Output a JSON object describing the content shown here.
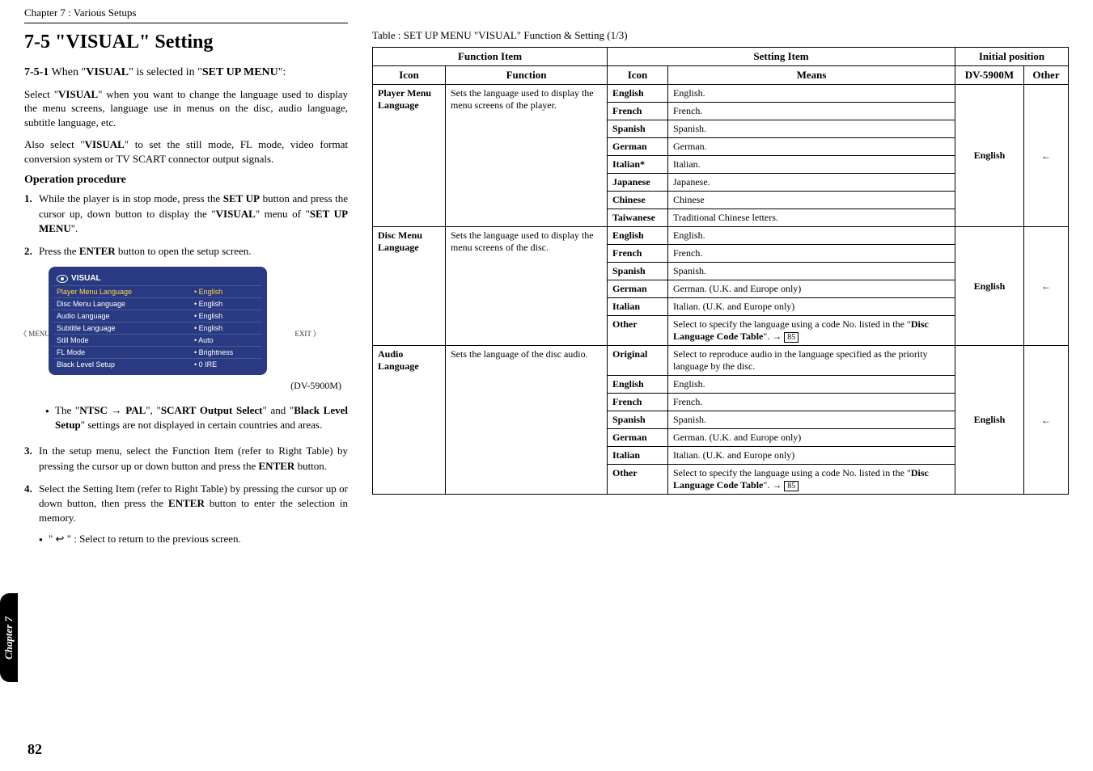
{
  "chapter_header": "Chapter 7 : Various Setups",
  "section": {
    "number": "7-5",
    "title": "\"VISUAL\" Setting",
    "sub_number": "7-5-1",
    "sub_text_pre": "When \"",
    "sub_kw1": "VISUAL",
    "sub_text_mid": "\" is selected in \"",
    "sub_kw2": "SET UP MENU",
    "sub_text_post": "\":",
    "para1_a": "Select \"",
    "para1_kw": "VISUAL",
    "para1_b": "\" when you want to change the language used to display the menu screens, language use in menus on the disc, audio language, subtitle language, etc.",
    "para2_a": "Also select \"",
    "para2_kw": "VISUAL",
    "para2_b": "\" to set the still mode, FL mode, video format conversion system or TV SCART connector output signals.",
    "op_proc": "Operation procedure",
    "steps": {
      "s1_a": "While the player is in stop mode, press the ",
      "s1_kw1": "SET UP",
      "s1_b": " button and press the cursor up, down button to display the \"",
      "s1_kw2": "VISUAL",
      "s1_c": "\" menu of \"",
      "s1_kw3": "SET UP MENU",
      "s1_d": "\".",
      "s2_a": "Press the ",
      "s2_kw": "ENTER",
      "s2_b": " button to open the setup screen.",
      "s3_a": "In the setup menu, select the Function Item (refer to Right Table) by pressing the cursor up or down button and press the ",
      "s3_kw": "ENTER",
      "s3_b": " button.",
      "s4_a": "Select the Setting Item (refer to Right Table) by pressing the cursor up or down button, then press the ",
      "s4_kw": "ENTER",
      "s4_b": " button to enter the selection in memory.",
      "s4_bullet": "\" ↩ \"  :  Select to return to the previous screen."
    },
    "bullet1_a": "The \"",
    "bullet1_kw1": "NTSC → PAL",
    "bullet1_b": "\", \"",
    "bullet1_kw2": "SCART Output Select",
    "bullet1_c": "\" and \"",
    "bullet1_kw3": "Black Level Setup",
    "bullet1_d": "\" settings are not displayed in certain countries and areas."
  },
  "osd": {
    "title": "VISUAL",
    "left_label": "MENU",
    "right_label": "EXIT",
    "model": "(DV-5900M)",
    "rows": [
      {
        "label": "Player Menu Language",
        "value": "• English",
        "hl": true
      },
      {
        "label": "Disc Menu Language",
        "value": "• English",
        "hl": false
      },
      {
        "label": "Audio Language",
        "value": "• English",
        "hl": false
      },
      {
        "label": "Subtitle Language",
        "value": "• English",
        "hl": false
      },
      {
        "label": "Still Mode",
        "value": "• Auto",
        "hl": false
      },
      {
        "label": "FL Mode",
        "value": "• Brightness",
        "hl": false
      },
      {
        "label": "Black Level Setup",
        "value": "• 0 IRE",
        "hl": false
      }
    ]
  },
  "table": {
    "caption": "Table : SET UP MENU \"VISUAL\" Function & Setting (1/3)",
    "headers": {
      "fi": "Function Item",
      "si": "Setting Item",
      "ip": "Initial position",
      "icon": "Icon",
      "function": "Function",
      "means": "Means",
      "dv5900m": "DV-5900M",
      "other": "Other"
    },
    "groups": [
      {
        "icon": "Player Menu Language",
        "function": "Sets the language used to display the menu screens of the player.",
        "ip": "English",
        "other": "←",
        "rows": [
          {
            "icon": "English",
            "means": "English."
          },
          {
            "icon": "French",
            "means": "French."
          },
          {
            "icon": "Spanish",
            "means": "Spanish."
          },
          {
            "icon": "German",
            "means": "German."
          },
          {
            "icon": "Italian*",
            "means": "Italian."
          },
          {
            "icon": "Japanese",
            "means": "Japanese."
          },
          {
            "icon": "Chinese",
            "means": "Chinese"
          },
          {
            "icon": "Taiwanese",
            "means": "Traditional Chinese letters."
          }
        ]
      },
      {
        "icon": "Disc Menu Language",
        "function": "Sets the language used to display the menu screens of the disc.",
        "ip": "English",
        "other": "←",
        "rows": [
          {
            "icon": "English",
            "means": "English."
          },
          {
            "icon": "French",
            "means": "French."
          },
          {
            "icon": "Spanish",
            "means": "Spanish."
          },
          {
            "icon": "German",
            "means": "German. (U.K. and Europe only)"
          },
          {
            "icon": "Italian",
            "means": "Italian. (U.K. and Europe only)"
          },
          {
            "icon": "Other",
            "means_html": true
          }
        ],
        "other_means_a": "Select to specify the language using a code No. listed in the \"",
        "other_means_kw": "Disc Language Code Table",
        "other_means_b": "\".  →"
      },
      {
        "icon": "Audio Language",
        "function": "Sets the language of the disc audio.",
        "ip": "English",
        "other": "←",
        "rows": [
          {
            "icon": "Original",
            "means": "Select to reproduce audio in the language specified as the priority language by the disc."
          },
          {
            "icon": "English",
            "means": "English."
          },
          {
            "icon": "French",
            "means": "French."
          },
          {
            "icon": "Spanish",
            "means": "Spanish."
          },
          {
            "icon": "German",
            "means": "German. (U.K. and Europe only)"
          },
          {
            "icon": "Italian",
            "means": "Italian. (U.K. and Europe only)"
          },
          {
            "icon": "Other",
            "means_html": true
          }
        ],
        "other_means_a": "Select to specify the language using a code No. listed in the \"",
        "other_means_kw": "Disc Language Code Table",
        "other_means_b": "\".  →"
      }
    ],
    "page_ref": "85"
  },
  "side_tab": "Chapter 7",
  "page_number": "82"
}
